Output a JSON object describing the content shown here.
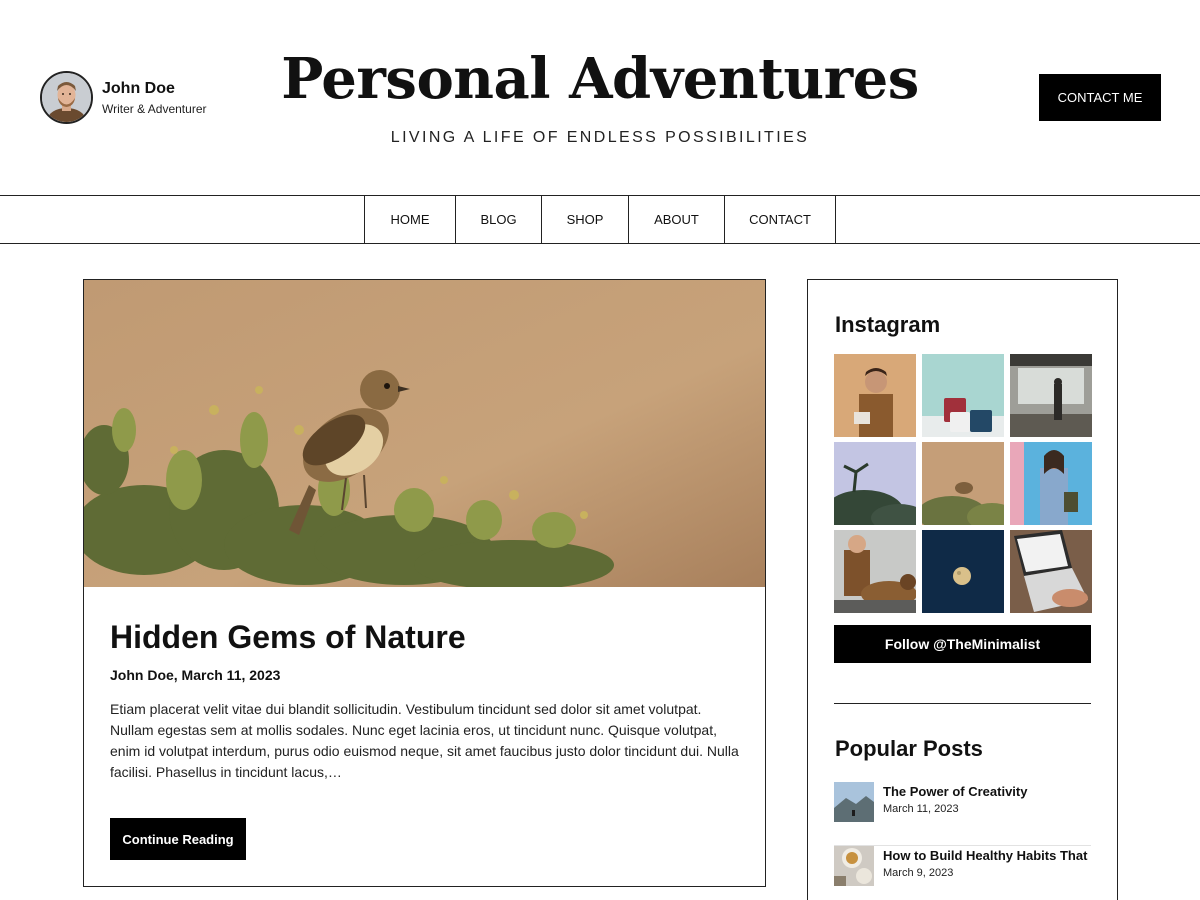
{
  "author": {
    "name": "John Doe",
    "role": "Writer & Adventurer"
  },
  "site": {
    "title": "Personal Adventures",
    "tagline": "LIVING A LIFE OF ENDLESS POSSIBILITIES"
  },
  "header": {
    "contact_button": "CONTACT ME"
  },
  "nav": {
    "items": [
      {
        "label": "HOME"
      },
      {
        "label": "BLOG"
      },
      {
        "label": "SHOP"
      },
      {
        "label": "ABOUT"
      },
      {
        "label": "CONTACT"
      }
    ]
  },
  "post": {
    "title": "Hidden Gems of Nature",
    "meta": "John Doe, March 11, 2023",
    "excerpt": "Etiam placerat velit vitae dui blandit sollicitudin. Vestibulum tincidunt sed dolor sit amet volutpat. Nullam egestas sem at mollis sodales. Nunc eget lacinia eros, ut tincidunt nunc. Quisque volutpat, enim id volutpat interdum, purus odio euismod neque, sit amet faucibus justo dolor tincidunt dui. Nulla facilisi. Phasellus in tincidunt lacus,…",
    "read_button": "Continue Reading"
  },
  "sidebar": {
    "instagram_heading": "Instagram",
    "follow_button": "Follow @TheMinimalist",
    "popular_heading": "Popular Posts",
    "popular_posts": [
      {
        "title": "The Power of Creativity",
        "date": "March 11, 2023"
      },
      {
        "title": "How to Build Healthy Habits That",
        "date": "March 9, 2023"
      }
    ]
  },
  "colors": {
    "primary": "#000000",
    "text": "#111111",
    "border": "#222222",
    "background": "#ffffff"
  }
}
